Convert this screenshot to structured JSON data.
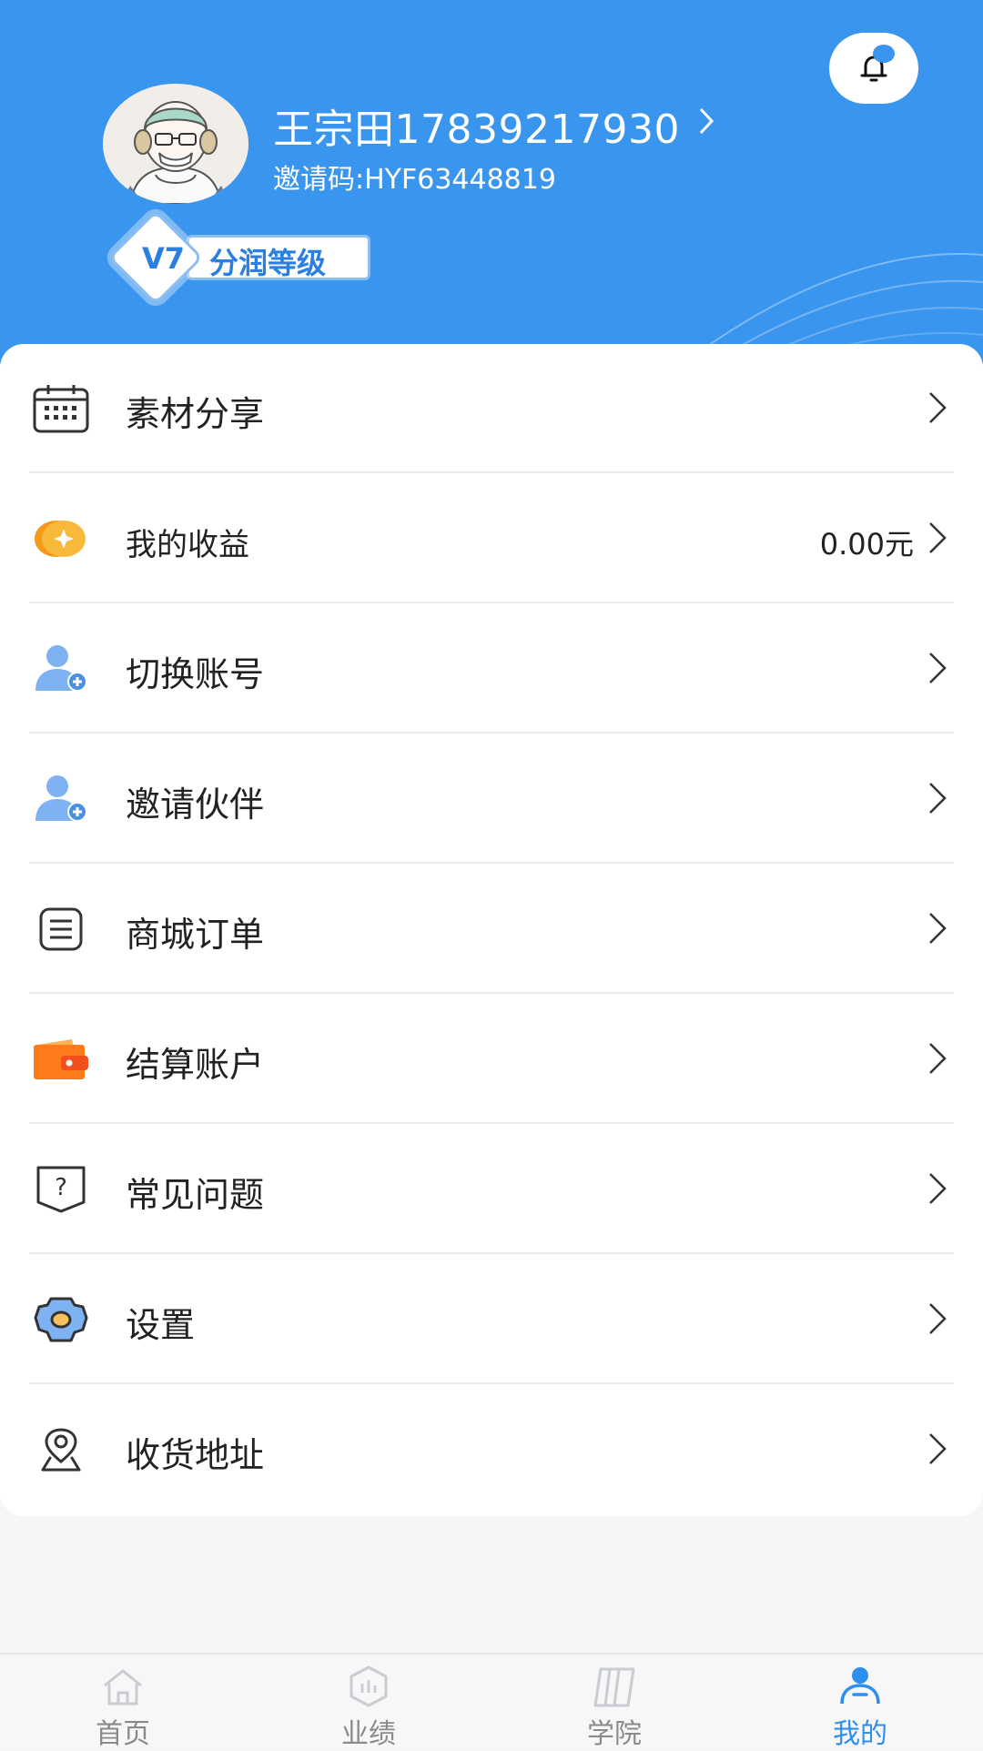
{
  "profile": {
    "name": "王宗田17839217930",
    "invite_code": "邀请码:HYF63448819",
    "level": "V7",
    "level_label": "分润等级"
  },
  "menu": {
    "items": [
      {
        "label": "素材分享",
        "icon": "calendar-icon",
        "value": ""
      },
      {
        "label": "我的收益",
        "icon": "coin-icon",
        "value": "0.00元"
      },
      {
        "label": "切换账号",
        "icon": "user-add-icon",
        "value": ""
      },
      {
        "label": "邀请伙伴",
        "icon": "user-add-icon",
        "value": ""
      },
      {
        "label": "商城订单",
        "icon": "list-icon",
        "value": ""
      },
      {
        "label": "结算账户",
        "icon": "wallet-icon",
        "value": ""
      },
      {
        "label": "常见问题",
        "icon": "question-icon",
        "value": ""
      },
      {
        "label": "设置",
        "icon": "gear-icon",
        "value": ""
      },
      {
        "label": "收货地址",
        "icon": "location-icon",
        "value": ""
      }
    ]
  },
  "tabbar": {
    "tabs": [
      {
        "label": "首页",
        "icon": "home-icon"
      },
      {
        "label": "业绩",
        "icon": "chart-icon"
      },
      {
        "label": "学院",
        "icon": "book-icon"
      },
      {
        "label": "我的",
        "icon": "user-icon"
      }
    ],
    "active": "我的"
  },
  "colors": {
    "header_bg": "#3a95ee",
    "accent": "#2f8ff0",
    "coin": "#f5a623",
    "wallet": "#ff7a1a"
  }
}
